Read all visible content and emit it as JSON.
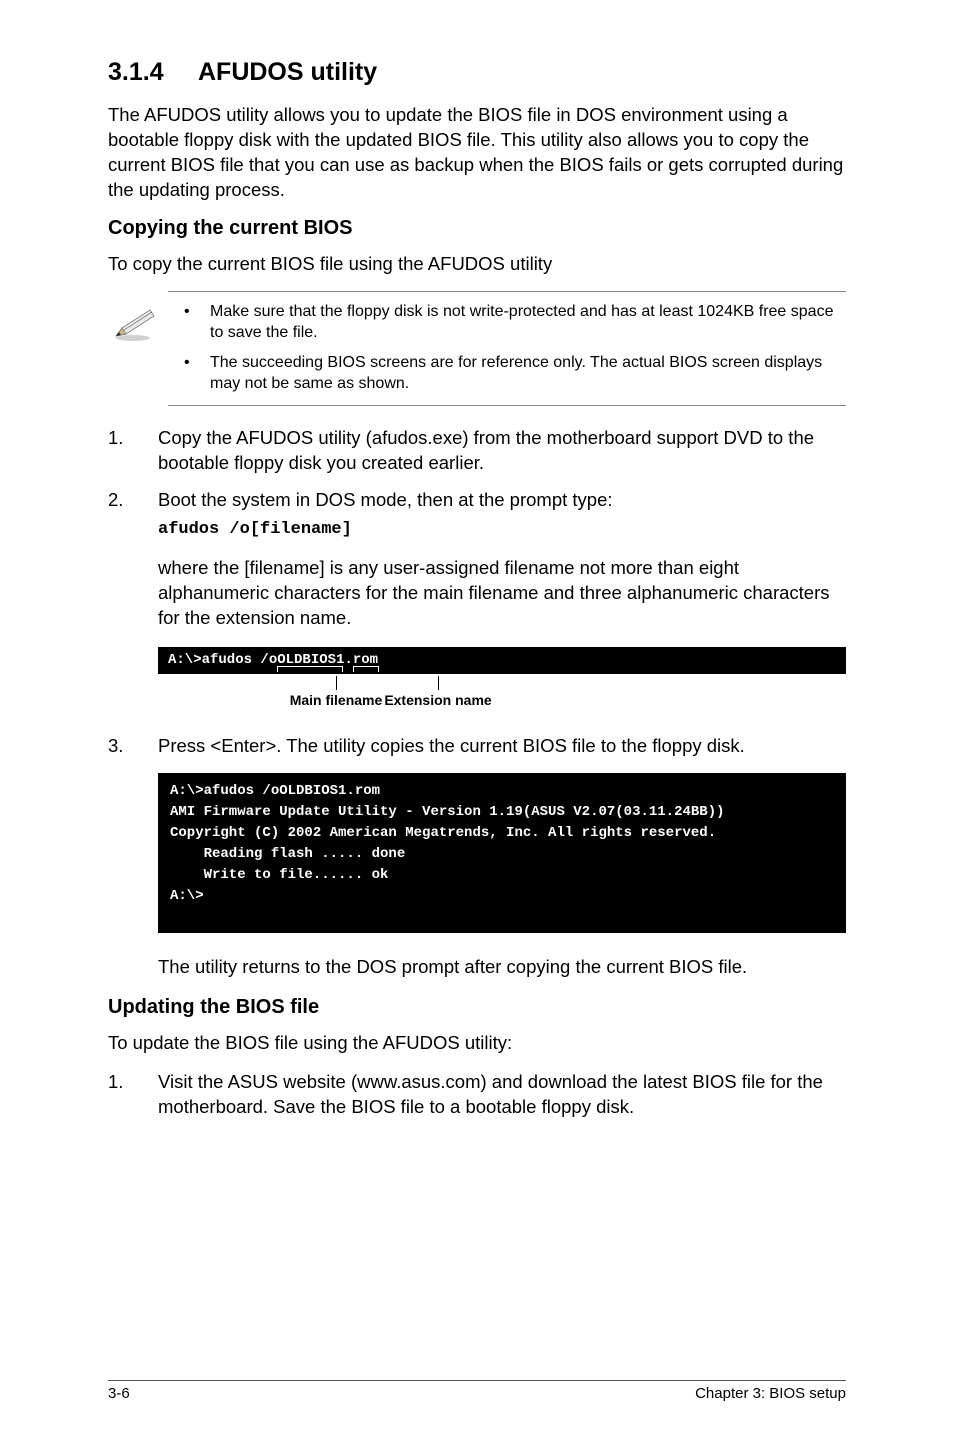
{
  "heading": {
    "number": "3.1.4",
    "title": "AFUDOS utility"
  },
  "intro": "The AFUDOS utility allows you to update the BIOS file in DOS environment using a bootable floppy disk with the updated BIOS file. This utility also allows you to copy the current BIOS file that you can use as backup when the BIOS fails or gets corrupted during the updating process.",
  "copy": {
    "heading": "Copying the current BIOS",
    "lead": "To copy the current BIOS file using the AFUDOS utility",
    "notes": [
      "Make sure that the floppy disk is not write-protected and has at least 1024KB free space to save the file.",
      "The succeeding BIOS screens are for reference only. The actual BIOS screen displays may not be same as shown."
    ],
    "step1_num": "1.",
    "step1": "Copy the AFUDOS utility (afudos.exe) from the motherboard support DVD to the bootable floppy disk you created earlier.",
    "step2_num": "2.",
    "step2_text": "Boot the system in DOS mode, then at the prompt type:",
    "step2_code": "afudos /o[filename]",
    "step2_explain": "where the [filename] is any user-assigned filename not more than eight alphanumeric characters  for the main filename and three alphanumeric characters for the extension name.",
    "term_small_prefix": "A:\\>afudos /o",
    "term_small_main": "OLDBIOS1",
    "term_small_dot": ".",
    "term_small_ext": "rom",
    "ann_main": "Main filename",
    "ann_ext": "Extension name",
    "step3_num": "3.",
    "step3_text": "Press <Enter>. The utility copies the current BIOS file to the floppy disk.",
    "term_big": "A:\\>afudos /oOLDBIOS1.rom\nAMI Firmware Update Utility - Version 1.19(ASUS V2.07(03.11.24BB))\nCopyright (C) 2002 American Megatrends, Inc. All rights reserved.\n    Reading flash ..... done\n    Write to file...... ok\nA:\\>",
    "after_term": "The utility returns to the DOS prompt after copying the current BIOS file."
  },
  "update": {
    "heading": "Updating the BIOS file",
    "lead": "To update the BIOS file using the AFUDOS utility:",
    "step1_num": "1.",
    "step1": "Visit the ASUS website (www.asus.com) and download the latest BIOS file for the motherboard. Save the BIOS file to a bootable floppy disk."
  },
  "footer": {
    "left": "3-6",
    "right": "Chapter 3: BIOS setup"
  }
}
